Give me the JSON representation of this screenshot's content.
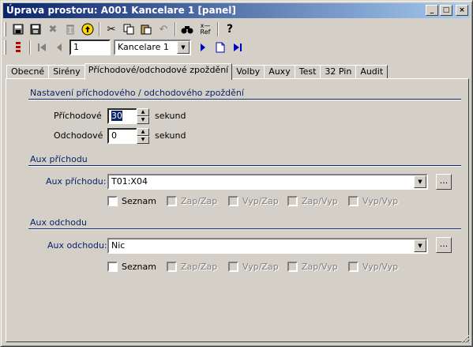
{
  "window": {
    "title": "Úprava prostoru: A001 Kancelare 1 [panel]",
    "min_label": "_",
    "max_label": "□",
    "close_label": "×"
  },
  "toolbar": {
    "record_number": "1",
    "record_select": "Kancelare 1",
    "ref_label": "Ref",
    "help_label": "?"
  },
  "tabs": [
    {
      "label": "Obecné",
      "active": false
    },
    {
      "label": "Sirény",
      "active": false
    },
    {
      "label": "Příchodové/odchodové zpoždění",
      "active": true
    },
    {
      "label": "Volby",
      "active": false
    },
    {
      "label": "Auxy",
      "active": false
    },
    {
      "label": "Test",
      "active": false
    },
    {
      "label": "32 Pin",
      "active": false
    },
    {
      "label": "Audit",
      "active": false
    }
  ],
  "delay_section": {
    "title": "Nastavení příchodového / odchodového zpoždění",
    "entry_label": "Příchodové",
    "entry_value": "30",
    "exit_label": "Odchodové",
    "exit_value": "0",
    "unit": "sekund"
  },
  "aux_entry": {
    "title": "Aux příchodu",
    "field_label": "Aux příchodu:",
    "value": "T01:X04",
    "browse_label": "...",
    "checkboxes": [
      {
        "label": "Seznam",
        "enabled": true
      },
      {
        "label": "Zap/Zap",
        "enabled": false
      },
      {
        "label": "Vyp/Zap",
        "enabled": false
      },
      {
        "label": "Zap/Vyp",
        "enabled": false
      },
      {
        "label": "Vyp/Vyp",
        "enabled": false
      }
    ]
  },
  "aux_exit": {
    "title": "Aux odchodu",
    "field_label": "Aux odchodu:",
    "value": "Nic",
    "browse_label": "...",
    "checkboxes": [
      {
        "label": "Seznam",
        "enabled": true
      },
      {
        "label": "Zap/Zap",
        "enabled": false
      },
      {
        "label": "Vyp/Zap",
        "enabled": false
      },
      {
        "label": "Zap/Vyp",
        "enabled": false
      },
      {
        "label": "Vyp/Vyp",
        "enabled": false
      }
    ]
  }
}
